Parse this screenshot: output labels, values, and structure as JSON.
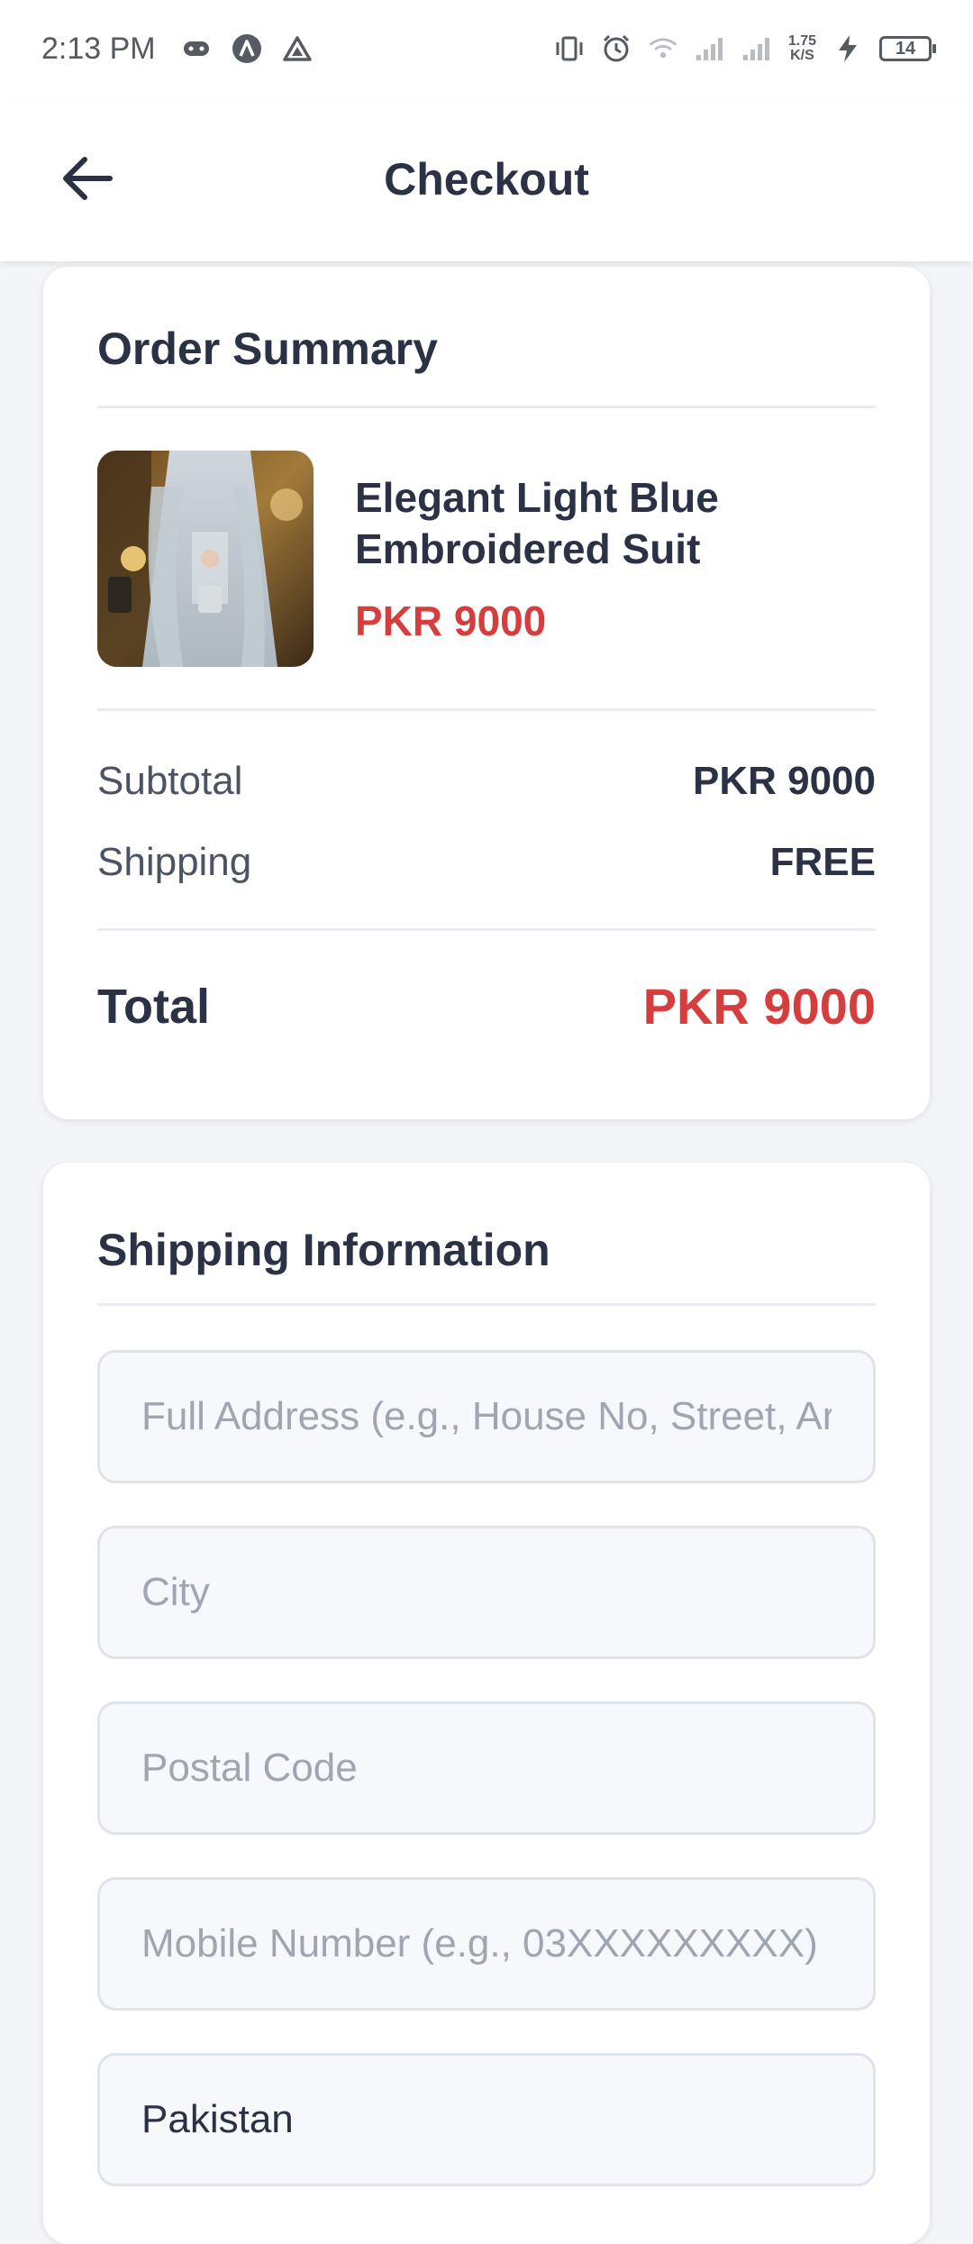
{
  "status_bar": {
    "time": "2:13 PM",
    "left_icons": [
      "game-controller-icon",
      "app-a-icon",
      "drive-triangle-icon"
    ],
    "right_icons": [
      "vibrate-icon",
      "alarm-icon",
      "wifi-icon",
      "signal-icon",
      "signal-icon"
    ],
    "speed_value": "1.75",
    "speed_unit": "K/S",
    "battery_level": "14"
  },
  "header": {
    "title": "Checkout",
    "back_icon": "arrow-left-icon"
  },
  "order_summary": {
    "title": "Order Summary",
    "product": {
      "name": "Elegant Light Blue Embroidered Suit",
      "price": "PKR 9000"
    },
    "subtotal_label": "Subtotal",
    "subtotal_value": "PKR 9000",
    "shipping_label": "Shipping",
    "shipping_value": "FREE",
    "total_label": "Total",
    "total_value": "PKR 9000"
  },
  "shipping_info": {
    "title": "Shipping Information",
    "address_placeholder": "Full Address (e.g., House No, Street, Area)",
    "city_placeholder": "City",
    "postal_placeholder": "Postal Code",
    "mobile_placeholder": "Mobile Number (e.g., 03XXXXXXXXX)",
    "country_value": "Pakistan"
  },
  "colors": {
    "accent_price": "#d63d3d",
    "text_primary": "#2b3245",
    "background": "#f3f5f9"
  }
}
